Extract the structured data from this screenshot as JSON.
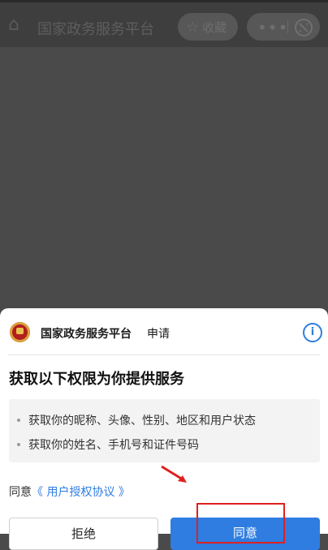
{
  "topbar": {
    "title": "国家政务服务平台",
    "favorite_label": "收藏",
    "more_label": "•••"
  },
  "sheet": {
    "app_name": "国家政务服务平台",
    "apply_label": "申请",
    "info_label": "i",
    "heading": "获取以下权限为你提供服务",
    "permissions": [
      "获取你的昵称、头像、性别、地区和用户状态",
      "获取你的姓名、手机号和证件号码"
    ],
    "agree_prefix": "同意",
    "agree_link": "《 用户授权协议 》",
    "reject_label": "拒绝",
    "allow_label": "同意"
  },
  "colors": {
    "accent": "#2f7de1",
    "annotation": "#e02020",
    "overlay": "#4a4a4a"
  }
}
